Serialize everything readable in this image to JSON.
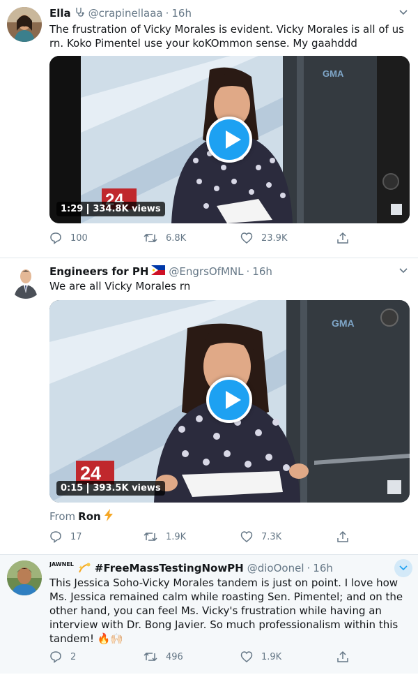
{
  "tweets": [
    {
      "name": "Ella",
      "handle": "@crapinellaaa",
      "separator": "·",
      "time": "16h",
      "text": "The frustration of Vicky Morales is evident. Vicky Morales is all of us rn. Koko Pimentel use your koKOmmon sense. My gaahddd",
      "video": {
        "duration": "1:29",
        "views": "334.8K views",
        "channel_logo": "GMA"
      },
      "replies": "100",
      "retweets": "6.8K",
      "likes": "23.9K"
    },
    {
      "name": "Engineers for PH",
      "handle": "@EngrsOfMNL",
      "separator": "·",
      "time": "16h",
      "text": "We are all Vicky Morales rn",
      "video": {
        "duration": "0:15",
        "views": "393.5K views",
        "channel_logo": "GMA"
      },
      "from_label": "From",
      "from_name": "Ron",
      "replies": "17",
      "retweets": "1.9K",
      "likes": "7.3K"
    },
    {
      "name_prefix": "JAWNEL",
      "name": "#FreeMassTestingNowPH",
      "handle": "@dioOonel",
      "separator": "·",
      "time": "16h",
      "text": "This Jessica Soho-Vicky Morales tandem is just on point. I love how Ms. Jessica remained calm while roasting Sen. Pimentel; and on the other hand, you can feel Ms. Vicky's frustration while having an interview with Dr. Bong Javier. So much professionalism within this tandem! 🔥🙌🏻",
      "replies": "2",
      "retweets": "496",
      "likes": "1.9K"
    }
  ],
  "icons": {
    "reply": "reply-icon",
    "retweet": "retweet-icon",
    "like": "heart-icon",
    "share": "share-icon",
    "caret": "chevron-down-icon"
  },
  "colors": {
    "accent": "#1da1f2",
    "secondary_text": "#657786",
    "primary_text": "#14171a",
    "highlight_bg": "#f5f8fa"
  }
}
